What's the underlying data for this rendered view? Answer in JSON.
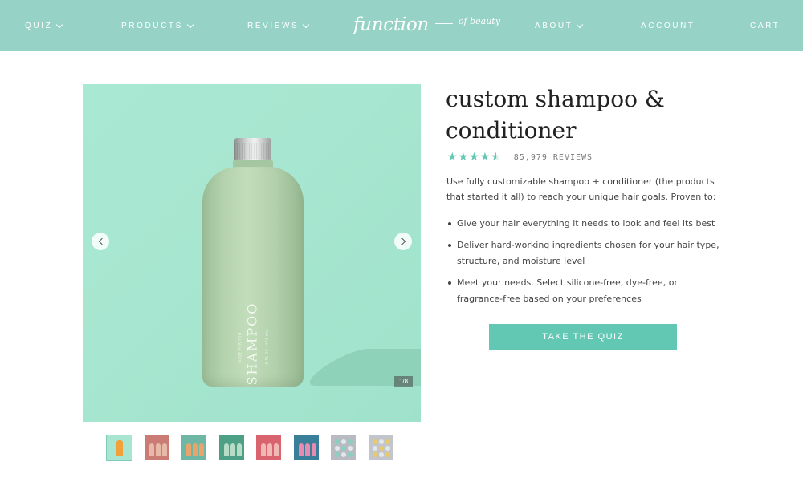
{
  "nav": {
    "left": [
      {
        "label": "QUIZ",
        "dropdown": true
      },
      {
        "label": "PRODUCTS",
        "dropdown": true
      },
      {
        "label": "REVIEWS",
        "dropdown": true
      }
    ],
    "logo": {
      "main": "function",
      "sub": "of beauty"
    },
    "right": [
      {
        "label": "ABOUT",
        "dropdown": true
      },
      {
        "label": "ACCOUNT",
        "dropdown": false
      },
      {
        "label": "CART",
        "dropdown": false
      }
    ]
  },
  "gallery": {
    "bottle_label": "SHAMPOO",
    "bottle_small_1": "MADE FOR YOU",
    "bottle_small_2": "16 FL OZ (473 mL)",
    "counter": "1/8",
    "thumbnails": [
      {
        "name": "orange-bottle",
        "bg": "#a8e6d1",
        "accent": "#f2a03a"
      },
      {
        "name": "pink-bottles",
        "bg": "#c97b74",
        "accent": "#e8b9a8"
      },
      {
        "name": "multi-bottles",
        "bg": "#6fb7a5",
        "accent": "#e8a46a"
      },
      {
        "name": "green-bottles",
        "bg": "#4d9f86",
        "accent": "#b7dcc8"
      },
      {
        "name": "red-bottles",
        "bg": "#d9646f",
        "accent": "#f1b9b6"
      },
      {
        "name": "blue-bottles",
        "bg": "#3a7f9a",
        "accent": "#e88bb0"
      },
      {
        "name": "ingredient-dots",
        "bg": "#b8bcc2",
        "accent": "#8ad0c0"
      },
      {
        "name": "ingredient-dots-2",
        "bg": "#c2c5cc",
        "accent": "#e9c96a"
      }
    ]
  },
  "product": {
    "title": "custom shampoo & conditioner",
    "rating": 4.5,
    "reviews": "85,979 REVIEWS",
    "description": "Use fully customizable shampoo + conditioner (the products that started it all) to reach your unique hair goals. Proven to:",
    "bullets": [
      "Give your hair everything it needs to look and feel its best",
      "Deliver hard-working ingredients chosen for your hair type, structure, and moisture level",
      "Meet your needs. Select silicone-free, dye-free, or fragrance-free based on your preferences"
    ],
    "cta": "TAKE THE QUIZ"
  },
  "colors": {
    "nav_bg": "#96d3c6",
    "accent": "#62c8b3",
    "hero_bg": "#a9e8d2"
  }
}
